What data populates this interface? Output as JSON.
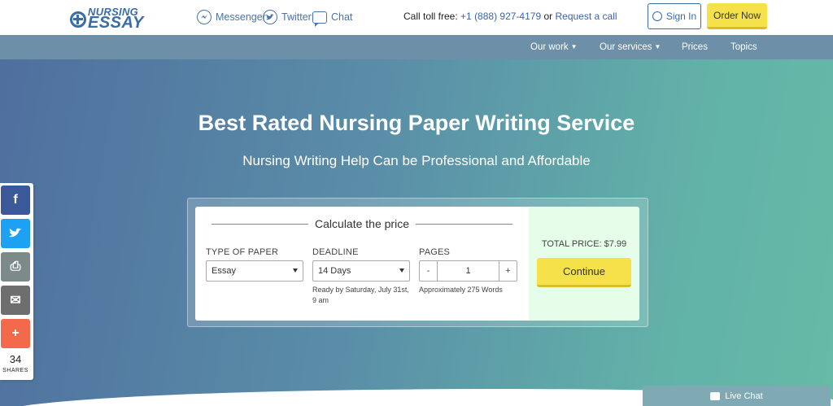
{
  "header": {
    "logo_line1": "NURSING",
    "logo_line2": "ESSAY",
    "messenger_label": "Messenger",
    "twitter_label": "Twitter",
    "chat_label": "Chat",
    "call_prefix": "Call toll free:",
    "phone": "+1 (888) 927-4179",
    "or_text": "or",
    "request_call": "Request a call",
    "signin_label": "Sign In",
    "order_label": "Order Now"
  },
  "nav": {
    "our_work": "Our work",
    "our_services": "Our services",
    "prices": "Prices",
    "topics": "Topics",
    "caret": "⌄"
  },
  "hero": {
    "title": "Best Rated Nursing Paper Writing Service",
    "subtitle": "Nursing Writing Help Can be Professional and Affordable"
  },
  "calculator": {
    "title": "Calculate the price",
    "type_label": "TYPE OF PAPER",
    "type_value": "Essay",
    "deadline_label": "DEADLINE",
    "deadline_value": "14 Days",
    "deadline_note": "Ready by Saturday, July 31st, 9 am",
    "pages_label": "PAGES",
    "pages_minus": "-",
    "pages_value": "1",
    "pages_plus": "+",
    "pages_note": "Approximately 275 Words",
    "total_price": "TOTAL PRICE: $7.99",
    "continue_label": "Continue"
  },
  "share": {
    "facebook_glyph": "f",
    "print_glyph": "⎙",
    "email_glyph": "✉",
    "more_glyph": "+",
    "count": "34",
    "label": "SHARES"
  },
  "livechat": {
    "label": "Live Chat"
  },
  "colors": {
    "brand_blue": "#3a6da8",
    "nav_bg": "#6e8fa8",
    "order_yellow": "#f5e14a",
    "total_bg": "#e6fde9",
    "facebook": "#3b5998",
    "twitter": "#1da1f2",
    "print": "#7c8a8a",
    "email": "#6e6e6e",
    "more": "#f26a4b"
  }
}
